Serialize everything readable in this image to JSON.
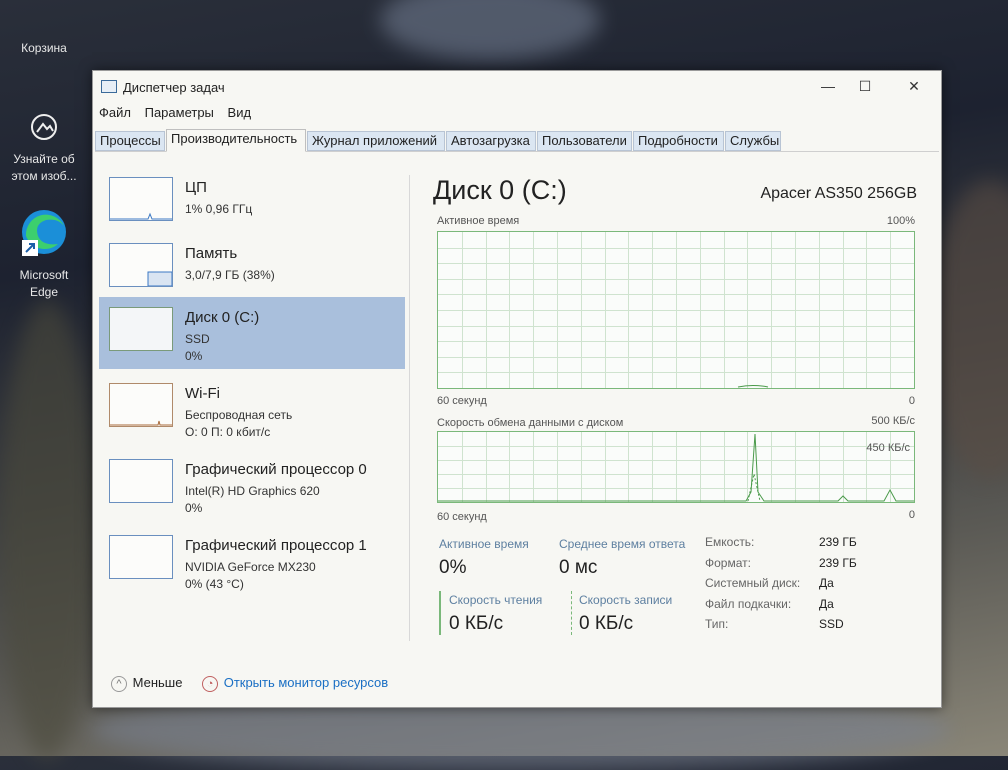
{
  "desktop": {
    "recycle_bin": "Корзина",
    "learn_more": [
      "Узнайте об",
      "этом изоб..."
    ],
    "edge": [
      "Microsoft",
      "Edge"
    ]
  },
  "window": {
    "title": "Диспетчер задач",
    "minimize": "—",
    "maximize": "☐",
    "close": "✕"
  },
  "menu": [
    "Файл",
    "Параметры",
    "Вид"
  ],
  "tabs": [
    "Процессы",
    "Производительность",
    "Журнал приложений",
    "Автозагрузка",
    "Пользователи",
    "Подробности",
    "Службы"
  ],
  "active_tab": "Производительность",
  "sidebar": [
    {
      "title": "ЦП",
      "sub": "1% 0,96 ГГц",
      "sub2": ""
    },
    {
      "title": "Память",
      "sub": "3,0/7,9 ГБ (38%)",
      "sub2": ""
    },
    {
      "title": "Диск 0 (C:)",
      "sub": "SSD",
      "sub2": "0%"
    },
    {
      "title": "Wi-Fi",
      "sub": "Беспроводная сеть",
      "sub2": "О: 0 П: 0 кбит/с"
    },
    {
      "title": "Графический процессор 0",
      "sub": "Intel(R) HD Graphics 620",
      "sub2": "0%"
    },
    {
      "title": "Графический процессор 1",
      "sub": "NVIDIA GeForce MX230",
      "sub2": "0% (43 °C)"
    }
  ],
  "detail": {
    "heading": "Диск 0 (C:)",
    "model": "Apacer AS350 256GB",
    "graph1": {
      "label": "Активное время",
      "max": "100%",
      "xleft": "60 секунд",
      "xright": "0"
    },
    "graph2": {
      "label": "Скорость обмена данными с диском",
      "max": "500 КБ/с",
      "mid": "450 КБ/с",
      "xleft": "60 секунд",
      "xright": "0"
    },
    "active_time_label": "Активное время",
    "active_time_value": "0%",
    "avg_response_label": "Среднее время ответа",
    "avg_response_value": "0 мс",
    "read_label": "Скорость чтения",
    "read_value": "0 КБ/с",
    "write_label": "Скорость записи",
    "write_value": "0 КБ/с",
    "props": [
      {
        "k": "Емкость:",
        "v": "239 ГБ"
      },
      {
        "k": "Формат:",
        "v": "239 ГБ"
      },
      {
        "k": "Системный диск:",
        "v": "Да"
      },
      {
        "k": "Файл подкачки:",
        "v": "Да"
      },
      {
        "k": "Тип:",
        "v": "SSD"
      }
    ]
  },
  "footer": {
    "less": "Меньше",
    "monitor": "Открыть монитор ресурсов"
  },
  "colors": {
    "accent": "#1a6fc4",
    "graph": "#7ab87a",
    "selected": "#a9bfdc"
  }
}
